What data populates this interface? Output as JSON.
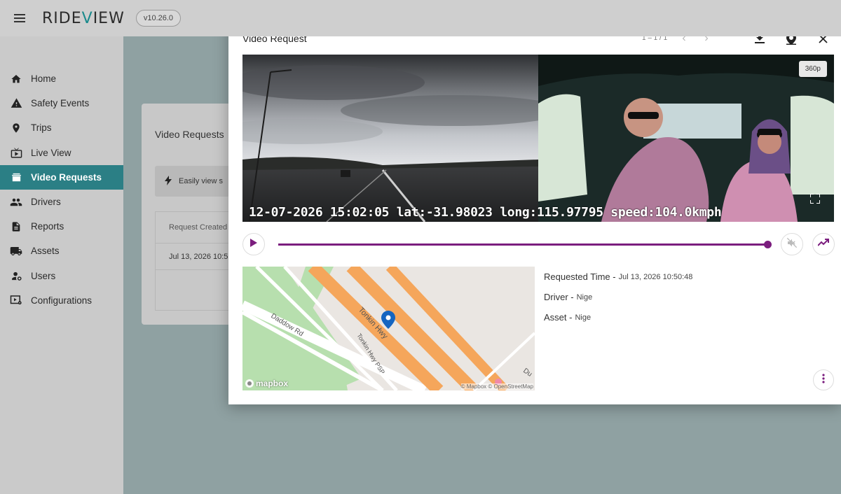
{
  "app": {
    "logo": "RIDEVIEW",
    "version": "v10.26.0"
  },
  "sidebar": {
    "items": [
      {
        "label": "Home",
        "icon": "home-icon"
      },
      {
        "label": "Safety Events",
        "icon": "warning-icon"
      },
      {
        "label": "Trips",
        "icon": "location-pin-icon"
      },
      {
        "label": "Live View",
        "icon": "live-tv-icon"
      },
      {
        "label": "Video Requests",
        "icon": "video-library-icon",
        "active": true
      },
      {
        "label": "Drivers",
        "icon": "people-icon"
      },
      {
        "label": "Reports",
        "icon": "document-icon"
      },
      {
        "label": "Assets",
        "icon": "truck-icon"
      },
      {
        "label": "Users",
        "icon": "user-settings-icon"
      },
      {
        "label": "Configurations",
        "icon": "settings-screen-icon"
      }
    ]
  },
  "background": {
    "title": "Video Requests",
    "banner": "Easily view s",
    "table_header": "Request Created",
    "table_cell": "Jul 13, 2026 10:5"
  },
  "modal": {
    "title": "Video Request",
    "pager": "1 – 1 / 1",
    "video": {
      "resolution": "360p",
      "overlay": "12-07-2026 15:02:05 lat:-31.98023 long:115.97795 speed:104.0kmph",
      "progress": 1.0
    },
    "map": {
      "roads": [
        "Tonkin Hwy",
        "Daddow Rd",
        "Tonkin Hwy PSP",
        "Du"
      ],
      "attribution": "© Mapbox © OpenStreetMap",
      "brand": "mapbox"
    },
    "info": {
      "requested_time_label": "Requested Time -",
      "requested_time_value": "Jul 13, 2026 10:50:48",
      "driver_label": "Driver -",
      "driver_value": "Nige",
      "asset_label": "Asset -",
      "asset_value": "Nige"
    }
  },
  "colors": {
    "accent": "#2b7f85",
    "progress": "#7b1d7e",
    "road_major": "#f5a65b"
  }
}
